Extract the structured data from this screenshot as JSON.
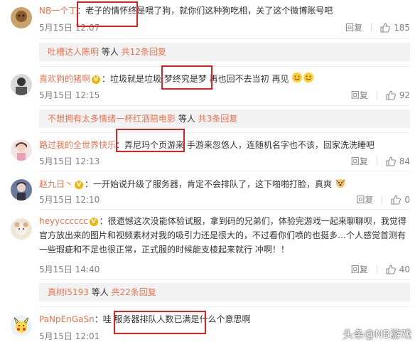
{
  "comments": [
    {
      "user": "NB一个丁",
      "text": "：老子的情怀终是喂了狗，就你们这种狗吃相，关了这个微博账号吧",
      "time": "5月15日 12:07",
      "reply": "回复",
      "likes": "185"
    },
    {
      "user": "喜欢狗的猪啊",
      "text": "：垃圾就是垃圾 梦终究是梦 再也回不去当初 再见",
      "time": "5月15日 12:15",
      "reply": "回复",
      "likes": "92"
    },
    {
      "user": "路过我的全世界快乐",
      "text": "：弄尼玛个页游来 手游来忽悠人，连随机名字也不该，回家洗洗睡吧",
      "time": "5月15日 12:13",
      "reply": "回复",
      "likes": "84"
    },
    {
      "user": "赵九日丶",
      "text": "：一开始说升级了服务器，肯定不会排队了，这下啪啪打脸，真爽",
      "time": "5月15日 12:10",
      "reply": "回复",
      "likes": "0"
    },
    {
      "user": "heyycccccc",
      "text": "：很遗憾这次没能体验试服，拿到码的兄弟们，体验完游戏一起来聊聊呗，我觉得官方放出来的图片和视频素材对我的吸引力还是很大的，不过看你们喷的也挺多…个人感觉首测有一些瑕疵和不足也很正常，正式服的时候能支棱起来就行 冲啊！！",
      "time": "5月15日 14:40",
      "reply": "回复",
      "likes": "40"
    },
    {
      "user": "PaNpEnGaSn",
      "text": "：哇 服务器排队人数已满是什么个意思啊",
      "time": "5月15日 12:01",
      "reply": "回复",
      "likes": ""
    }
  ],
  "subreplies": [
    {
      "user": "吐槽达人陈明",
      "mid": " 等人 ",
      "total": "共12条回复"
    },
    {
      "user": "不想拥有太多情绪一杯红酒陪电影",
      "mid": " 等人 ",
      "total": "共3条回复"
    },
    {
      "user": "真树i5193",
      "mid": " 等人 ",
      "total": "共22条回复"
    }
  ],
  "watermark": "头条@NB游戏",
  "colors": {
    "username": "#eb7350",
    "highlight": "#e02020",
    "subbar_bg": "#f2f2f2"
  }
}
